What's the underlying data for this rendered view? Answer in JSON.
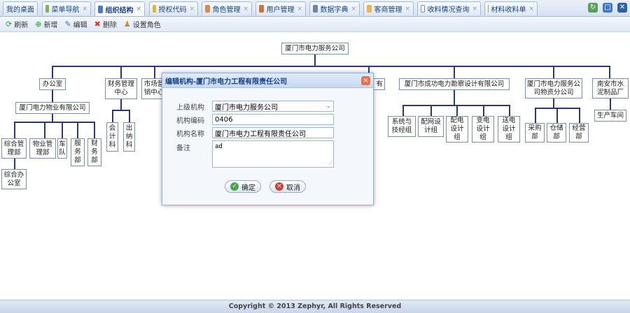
{
  "tabs": [
    {
      "label": "我的桌面",
      "icon": "none",
      "closable": false
    },
    {
      "label": "菜单导航",
      "icon": "tree-icon",
      "closable": true
    },
    {
      "label": "组织结构",
      "icon": "org-chart-icon",
      "closable": true,
      "active": true
    },
    {
      "label": "授权代码",
      "icon": "key-icon",
      "closable": true
    },
    {
      "label": "角色管理",
      "icon": "role-icon",
      "closable": true
    },
    {
      "label": "用户管理",
      "icon": "user-icon",
      "closable": true
    },
    {
      "label": "数据字典",
      "icon": "dictionary-icon",
      "closable": true
    },
    {
      "label": "客商管理",
      "icon": "merchant-icon",
      "closable": true
    },
    {
      "label": "收料情况查询",
      "icon": "window-icon",
      "closable": true
    },
    {
      "label": "材料收料单",
      "icon": "home-icon",
      "closable": true
    }
  ],
  "toolbar": {
    "refresh": "刷新",
    "add": "新增",
    "edit": "编辑",
    "delete": "删除",
    "set_role": "设置角色"
  },
  "org": {
    "root": "厦门市电力服务公司",
    "office": "办公室",
    "property_company": "厦门电力物业有限公司",
    "dept_admin": "综合管理部",
    "dept_property": "物业管理部",
    "dept_fleet": "车队",
    "dept_service": "服务部",
    "dept_finance": "财务部",
    "comprehensive_office": "综合办公室",
    "finance_center": "财务管理中心",
    "accounting": "会计科",
    "cashier": "出纳科",
    "market_center": "市场营销中心",
    "partial_node": "有",
    "survey_company": "厦门市成功电力勘察设计有限公司",
    "system_tech": "系统与技经组",
    "grid_design": "配网设计组",
    "distribution_design": "配电设计组",
    "substation_design": "变电设计组",
    "transmission_design": "送电设计组",
    "materials_company": "厦门市电力服务公司物资分公司",
    "purchasing": "采购部",
    "warehouse": "仓储部",
    "operations": "经营部",
    "cement_factory": "南安市水泥制品厂",
    "production_workshop": "生产车间"
  },
  "dialog": {
    "title": "编辑机构-厦门市电力工程有限责任公司",
    "parent_label": "上级机构",
    "parent_value": "厦门市电力服务公司",
    "code_label": "机构编码",
    "code_value": "0406",
    "name_label": "机构名称",
    "name_value": "厦门市电力工程有限责任公司",
    "remark_label": "备注",
    "remark_value": "ad",
    "ok": "确定",
    "cancel": "取消"
  },
  "footer": "Copyright © 2013 Zephyr, All Rights Reserved"
}
